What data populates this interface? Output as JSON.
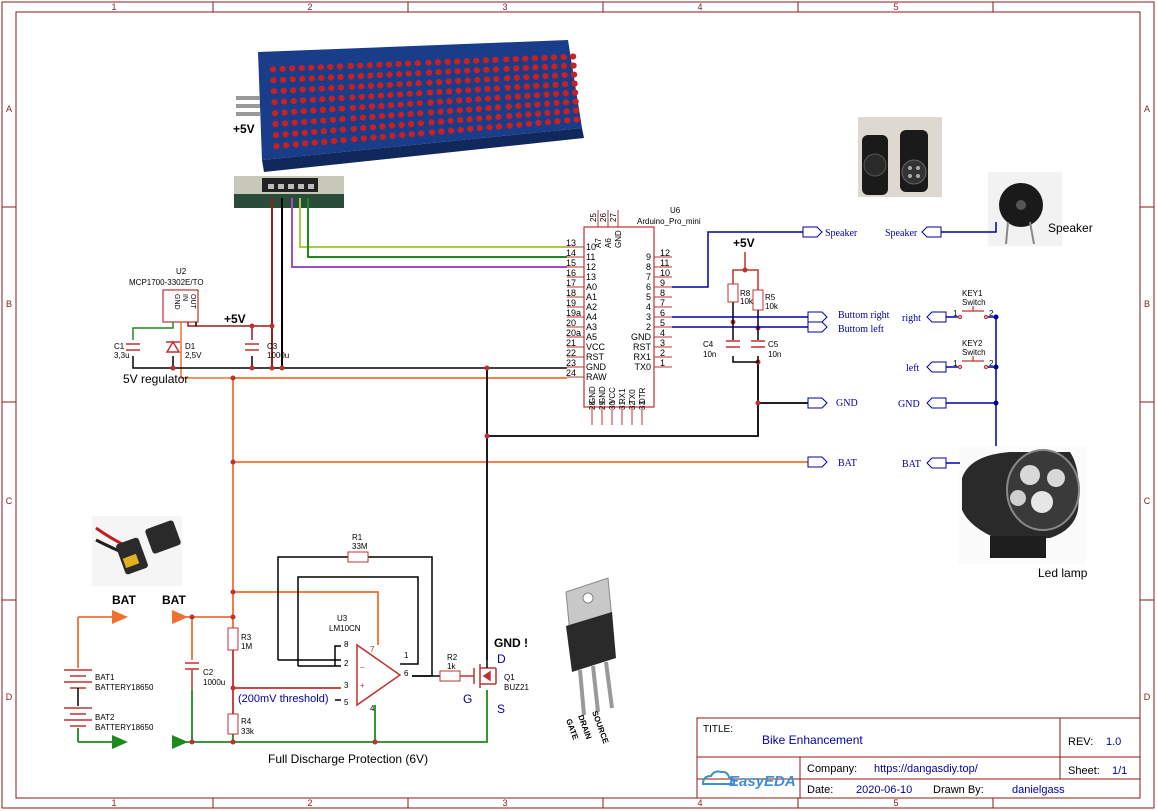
{
  "border": {
    "cols": [
      "1",
      "2",
      "3",
      "4",
      "5"
    ],
    "rows": [
      "A",
      "B",
      "C",
      "D"
    ]
  },
  "title_block": {
    "title_label": "TITLE:",
    "title": "Bike Enhancement",
    "rev_label": "REV:",
    "rev": "1.0",
    "company_label": "Company:",
    "company": "https://dangasdiy.top/",
    "sheet_label": "Sheet:",
    "sheet": "1/1",
    "date_label": "Date:",
    "date": "2020-06-10",
    "drawn_label": "Drawn By:",
    "drawn_by": "danielgass",
    "logo": "EasyEDA"
  },
  "labels": {
    "regulator_caption": "5V regulator",
    "protection_caption": "Full Discharge Protection (6V)",
    "threshold": "(200mV threshold)",
    "gnd_warning": "GND !",
    "speaker_caption": "Speaker",
    "led_caption": "Led lamp",
    "plus5v_a": "+5V",
    "plus5v_b": "+5V",
    "plus5v_c": "+5V",
    "bat_a": "BAT",
    "bat_b": "BAT",
    "mosfet_d": "D",
    "mosfet_g": "G",
    "mosfet_s": "S",
    "to220_pins": [
      "GATE",
      "DRAIN",
      "SOURCE"
    ]
  },
  "net_ports": {
    "speaker_out": "Speaker",
    "speaker_in": "Speaker",
    "btn_right_out": "Buttom right",
    "btn_left_out": "Buttom left",
    "gnd_out": "GND",
    "bat_out": "BAT",
    "right_in": "right",
    "left_in": "left",
    "gnd_in": "GND",
    "bat_in": "BAT"
  },
  "components": {
    "u2_ref": "U2",
    "u2_part": "MCP1700-3302E/TO",
    "u2_pins": [
      "GND",
      "IN",
      "OUT"
    ],
    "c1_ref": "C1",
    "c1_val": "3,3u",
    "d1_ref": "D1",
    "d1_val": "2,5V",
    "c3_ref": "C3",
    "c3_val": "1000u",
    "u6_ref": "U6",
    "u6_part": "Arduino_Pro_mini",
    "r8_ref": "R8",
    "r8_val": "10k",
    "r5_ref": "R5",
    "r5_val": "10k",
    "c4_ref": "C4",
    "c4_val": "10n",
    "c5_ref": "C5",
    "c5_val": "10n",
    "key1_ref": "KEY1",
    "key1_val": "Switch",
    "key2_ref": "KEY2",
    "key2_val": "Switch",
    "r1_ref": "R1",
    "r1_val": "33M",
    "u3_ref": "U3",
    "u3_part": "LM10CN",
    "r2_ref": "R2",
    "r2_val": "1k",
    "q1_ref": "Q1",
    "q1_part": "BUZ21",
    "r3_ref": "R3",
    "r3_val": "1M",
    "r4_ref": "R4",
    "r4_val": "33k",
    "c2_ref": "C2",
    "c2_val": "1000u",
    "bat1_ref": "BAT1",
    "bat1_val": "BATTERY18650",
    "bat2_ref": "BAT2",
    "bat2_val": "BATTERY18650",
    "u3_pins": [
      "8",
      "2",
      "3",
      "5",
      "7",
      "1",
      "6",
      "4"
    ],
    "sw_pins": [
      "1",
      "2",
      "1",
      "2"
    ]
  },
  "arduino": {
    "left_nums": [
      "13",
      "14",
      "15",
      "16",
      "17",
      "18",
      "19",
      "19a",
      "20",
      "20a",
      "21",
      "22",
      "23",
      "24"
    ],
    "left_names": [
      "10",
      "11",
      "12",
      "13",
      "A0",
      "A1",
      "A2",
      "A4",
      "A3",
      "A5",
      "VCC",
      "RST",
      "GND",
      "RAW"
    ],
    "right_nums": [
      "12",
      "11",
      "10",
      "9",
      "8",
      "7",
      "6",
      "5",
      "4",
      "3",
      "2",
      "1"
    ],
    "right_names": [
      "9",
      "8",
      "7",
      "6",
      "5",
      "4",
      "3",
      "2",
      "GND",
      "RST",
      "RX1",
      "TX0"
    ],
    "top_nums": [
      "25",
      "26",
      "27"
    ],
    "top_names": [
      "A7",
      "A6",
      "GND"
    ],
    "bottom_nums": [
      "28",
      "29",
      "30",
      "31",
      "32",
      "33"
    ],
    "bottom_names": [
      "GND",
      "GND",
      "VCC",
      "RX1",
      "TX0",
      "DTR"
    ]
  },
  "colors": {
    "border": "#8b1a1a",
    "wire_black": "#000000",
    "wire_orange": "#f07030",
    "wire_blue": "#0000a0",
    "wire_green": "#1e8a1e",
    "wire_yellowgreen": "#a8cc40",
    "wire_purple": "#9a50c8",
    "component_red": "#c03030",
    "text_blue": "#0000aa",
    "matrix_blue": "#1a3d8a",
    "led_dot_red": "#cc2020"
  }
}
